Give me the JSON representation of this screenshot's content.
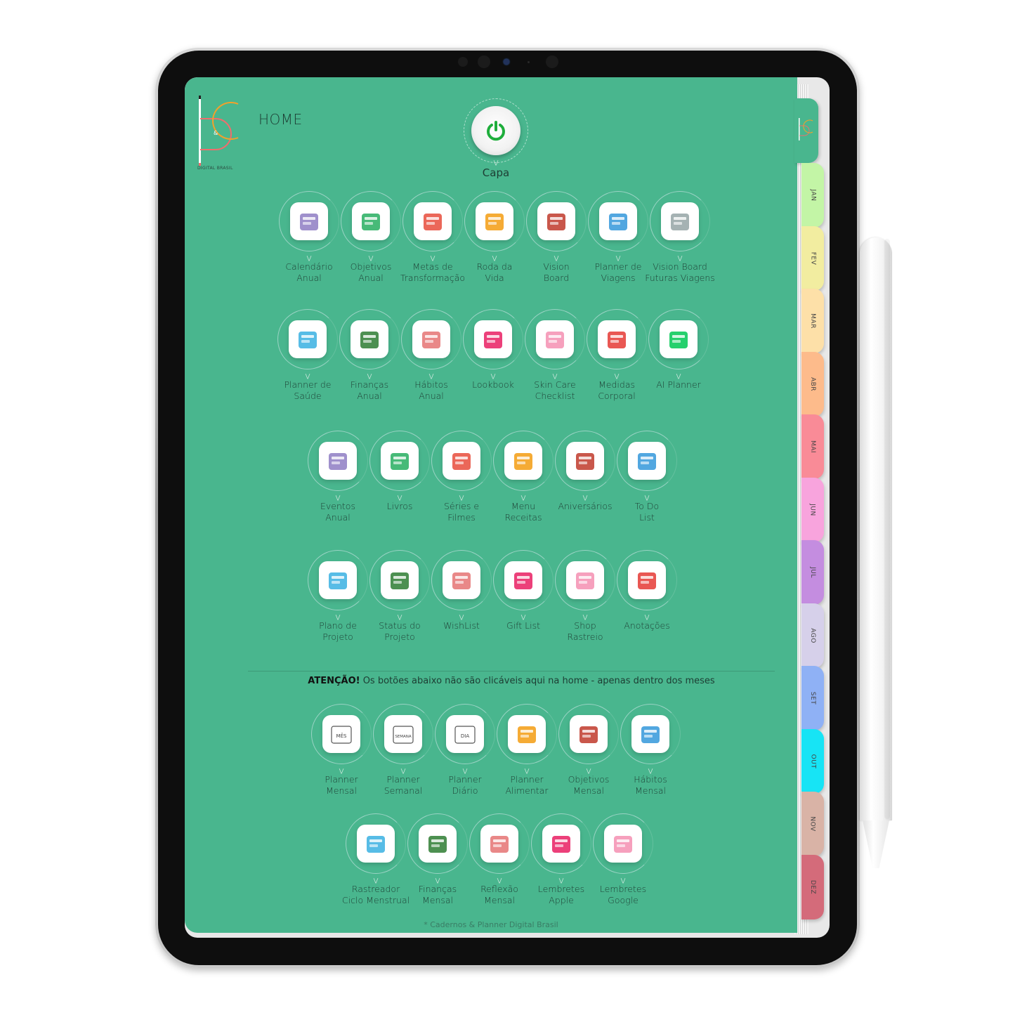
{
  "app": {
    "page_title": "HOME",
    "logo_text": "DIGITAL BRASIL",
    "cover_button": {
      "label": "Capa",
      "icon": "power-icon"
    }
  },
  "colors": {
    "page_bg": "#49b68e",
    "power_icon": "#1fae3c",
    "text": "#1d3d33"
  },
  "sections": {
    "row1": [
      {
        "label": "Calendário\nAnual",
        "icon": "calendar-grid-icon"
      },
      {
        "label": "Objetivos\nAnual",
        "icon": "growth-chart-icon"
      },
      {
        "label": "Metas de\nTransformação",
        "icon": "target-star-icon"
      },
      {
        "label": "Roda da\nVida",
        "icon": "color-wheel-icon"
      },
      {
        "label": "Vision\nBoard",
        "icon": "photo-board-icon"
      },
      {
        "label": "Planner de\nViagens",
        "icon": "suitcase-icon"
      },
      {
        "label": "Vision Board\nFuturas Viagens",
        "icon": "airplane-icon"
      }
    ],
    "row2": [
      {
        "label": "Planner de\nSaúde",
        "icon": "medical-kit-icon"
      },
      {
        "label": "Finanças\nAnual",
        "icon": "money-bag-icon"
      },
      {
        "label": "Hábitos\nAnual",
        "icon": "flag-hill-icon"
      },
      {
        "label": "Lookbook",
        "icon": "hanger-icon"
      },
      {
        "label": "Skin Care\nChecklist",
        "icon": "cosmetics-icon"
      },
      {
        "label": "Medidas\nCorporal",
        "icon": "apple-tape-icon"
      },
      {
        "label": "AI Planner",
        "icon": "robot-icon"
      }
    ],
    "row3": [
      {
        "label": "Eventos\nAnual",
        "icon": "champagne-icon"
      },
      {
        "label": "Livros",
        "icon": "books-icon"
      },
      {
        "label": "Séries e\nFilmes",
        "icon": "tv-icon"
      },
      {
        "label": "Menu\nReceitas",
        "icon": "chef-hat-icon"
      },
      {
        "label": "Aniversários",
        "icon": "cake-icon"
      },
      {
        "label": "To Do\nList",
        "icon": "checklist-icon"
      }
    ],
    "row4": [
      {
        "label": "Plano de\nProjeto",
        "icon": "head-gears-icon"
      },
      {
        "label": "Status do\nProjeto",
        "icon": "bar-progress-icon"
      },
      {
        "label": "WishList",
        "icon": "calendar-star-icon"
      },
      {
        "label": "Gift List",
        "icon": "gift-bag-icon"
      },
      {
        "label": "Shop\nRastreio",
        "icon": "scooter-icon"
      },
      {
        "label": "Anotações",
        "icon": "notepad-icon"
      }
    ],
    "notice": {
      "strong": "ATENÇÃO!",
      "text": " Os botões abaixo não são clicáveis aqui na home - apenas dentro dos meses"
    },
    "row5": [
      {
        "label": "Planner\nMensal",
        "icon": "calendar-month-icon",
        "tile_text": "MÊS"
      },
      {
        "label": "Planner\nSemanal",
        "icon": "week-slider-icon",
        "tile_text": "SEMANA"
      },
      {
        "label": "Planner\nDiário",
        "icon": "day-slider-icon",
        "tile_text": "DIA"
      },
      {
        "label": "Planner\nAlimentar",
        "icon": "frying-pan-icon"
      },
      {
        "label": "Objetivos\nMensal",
        "icon": "bullseye-icon"
      },
      {
        "label": "Hábitos\nMensal",
        "icon": "flag-path-icon"
      }
    ],
    "row6": [
      {
        "label": "Rastreador\nCiclo Menstrual",
        "icon": "cycle-calendar-icon"
      },
      {
        "label": "Finanças\nMensal",
        "icon": "piggy-bank-icon"
      },
      {
        "label": "Reflexão\nMensal",
        "icon": "calendar-search-icon"
      },
      {
        "label": "Lembretes\nApple",
        "icon": "calendar-hourglass-icon"
      },
      {
        "label": "Lembretes\nGoogle",
        "icon": "calendar-alarm-icon"
      }
    ]
  },
  "footer": "* Cadernos & Planner Digital Brasil",
  "month_tabs": [
    {
      "label": "JAN",
      "color": "#c3f5a6"
    },
    {
      "label": "FEV",
      "color": "#f2eda0"
    },
    {
      "label": "MAR",
      "color": "#fde0a8"
    },
    {
      "label": "ABR",
      "color": "#fdbb8b"
    },
    {
      "label": "MAI",
      "color": "#f98b97"
    },
    {
      "label": "JUN",
      "color": "#f8a4dd"
    },
    {
      "label": "JUL",
      "color": "#c48de0"
    },
    {
      "label": "AGO",
      "color": "#d6d0ea"
    },
    {
      "label": "SET",
      "color": "#8fb1f5"
    },
    {
      "label": "OUT",
      "color": "#17e4f5"
    },
    {
      "label": "NOV",
      "color": "#d9b3a6"
    },
    {
      "label": "DEZ",
      "color": "#d46b7a"
    }
  ]
}
